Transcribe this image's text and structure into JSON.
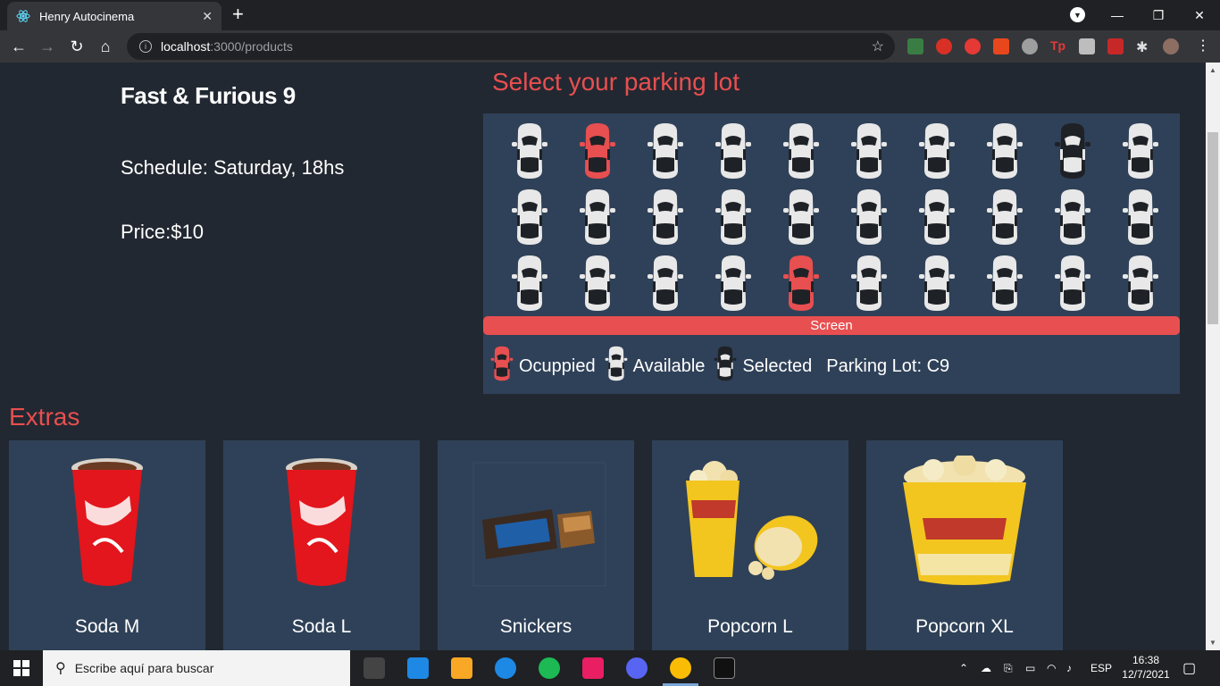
{
  "browser": {
    "tab_title": "Henry Autocinema",
    "tab_close": "✕",
    "new_tab": "+",
    "url_host": "localhost",
    "url_path": ":3000/products",
    "win_minimize": "—",
    "win_restore": "❐",
    "win_close": "✕"
  },
  "movie": {
    "title": "Fast & Furious 9",
    "schedule": "Schedule: Saturday, 18hs",
    "price": "Price:$10"
  },
  "parking": {
    "heading": "Select your parking lot",
    "screen_label": "Screen",
    "rows": [
      [
        "available",
        "occupied",
        "available",
        "available",
        "available",
        "available",
        "available",
        "available",
        "selected",
        "available"
      ],
      [
        "available",
        "available",
        "available",
        "available",
        "available",
        "available",
        "available",
        "available",
        "available",
        "available"
      ],
      [
        "available",
        "available",
        "available",
        "available",
        "occupied",
        "available",
        "available",
        "available",
        "available",
        "available"
      ]
    ],
    "legend": {
      "occupied": "Ocuppied",
      "available": "Available",
      "selected": "Selected",
      "lot": "Parking Lot: C9"
    },
    "colors": {
      "occupied": "#e84f50",
      "available": "#e8e8e8",
      "selected": "#1e2227"
    }
  },
  "extras": {
    "heading": "Extras",
    "products": [
      {
        "name": "Soda M",
        "image": "coca-cola-cup"
      },
      {
        "name": "Soda L",
        "image": "coca-cola-cup"
      },
      {
        "name": "Snickers",
        "image": "snickers-bar"
      },
      {
        "name": "Popcorn L",
        "image": "popcorn-cup"
      },
      {
        "name": "Popcorn XL",
        "image": "popcorn-bucket"
      }
    ]
  },
  "taskbar": {
    "search_placeholder": "Escribe aquí para buscar",
    "language": "ESP",
    "time": "16:38",
    "date": "12/7/2021"
  },
  "theme": {
    "accent": "#e84f50",
    "background": "#222831",
    "panel": "#2f4158"
  }
}
